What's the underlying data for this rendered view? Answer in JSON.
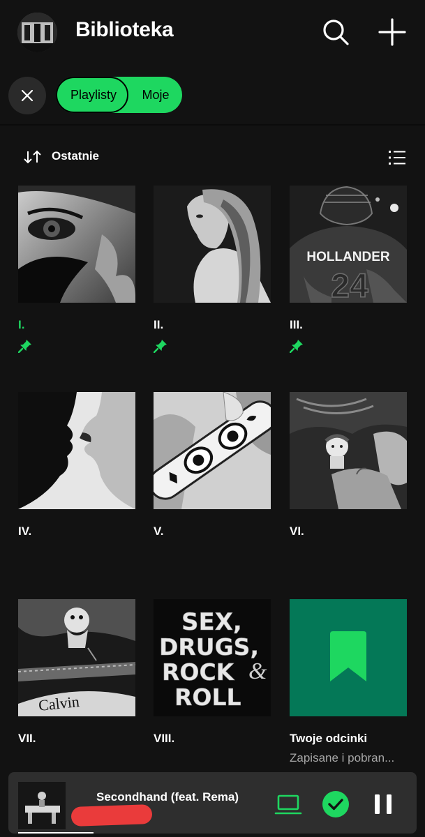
{
  "header": {
    "title": "Biblioteka",
    "icons": {
      "avatar": "profile-avatar",
      "search": "search-icon",
      "add": "plus-icon"
    }
  },
  "filters": {
    "chips": [
      {
        "label": "Playlisty",
        "selected": true
      },
      {
        "label": "Moje",
        "selected": true
      }
    ],
    "clear_icon": "close-icon"
  },
  "sort": {
    "label": "Ostatnie",
    "icon": "sort-arrows-icon",
    "view_icon": "list-view-icon"
  },
  "items": [
    {
      "title": "I.",
      "pinned": true,
      "highlighted": true
    },
    {
      "title": "II.",
      "pinned": true,
      "highlighted": false
    },
    {
      "title": "III.",
      "pinned": true,
      "highlighted": false
    },
    {
      "title": "IV.",
      "pinned": false,
      "highlighted": false
    },
    {
      "title": "V.",
      "pinned": false,
      "highlighted": false
    },
    {
      "title": "VI.",
      "pinned": false,
      "highlighted": false
    },
    {
      "title": "VII.",
      "pinned": false,
      "highlighted": false
    },
    {
      "title": "VIII.",
      "pinned": false,
      "highlighted": false
    },
    {
      "title": "Twoje odcinki",
      "subtitle": "Zapisane i pobran...",
      "pinned": false,
      "highlighted": false
    }
  ],
  "covers": {
    "iii_text": "HOLLANDER",
    "iii_number": "24",
    "vii_text": "Calvin",
    "viii_lines": [
      "SEX,",
      "DRUGS,",
      "ROCK",
      "ROLL"
    ],
    "viii_amp": "&"
  },
  "player": {
    "title": "Secondhand (feat. Rema)",
    "device_icon": "device-laptop-icon",
    "saved_icon": "check-circle-icon",
    "pause_icon": "pause-icon",
    "progress": 0.19
  },
  "colors": {
    "accent": "#1ed760",
    "background": "#121212",
    "episodes_bg": "#047857"
  }
}
